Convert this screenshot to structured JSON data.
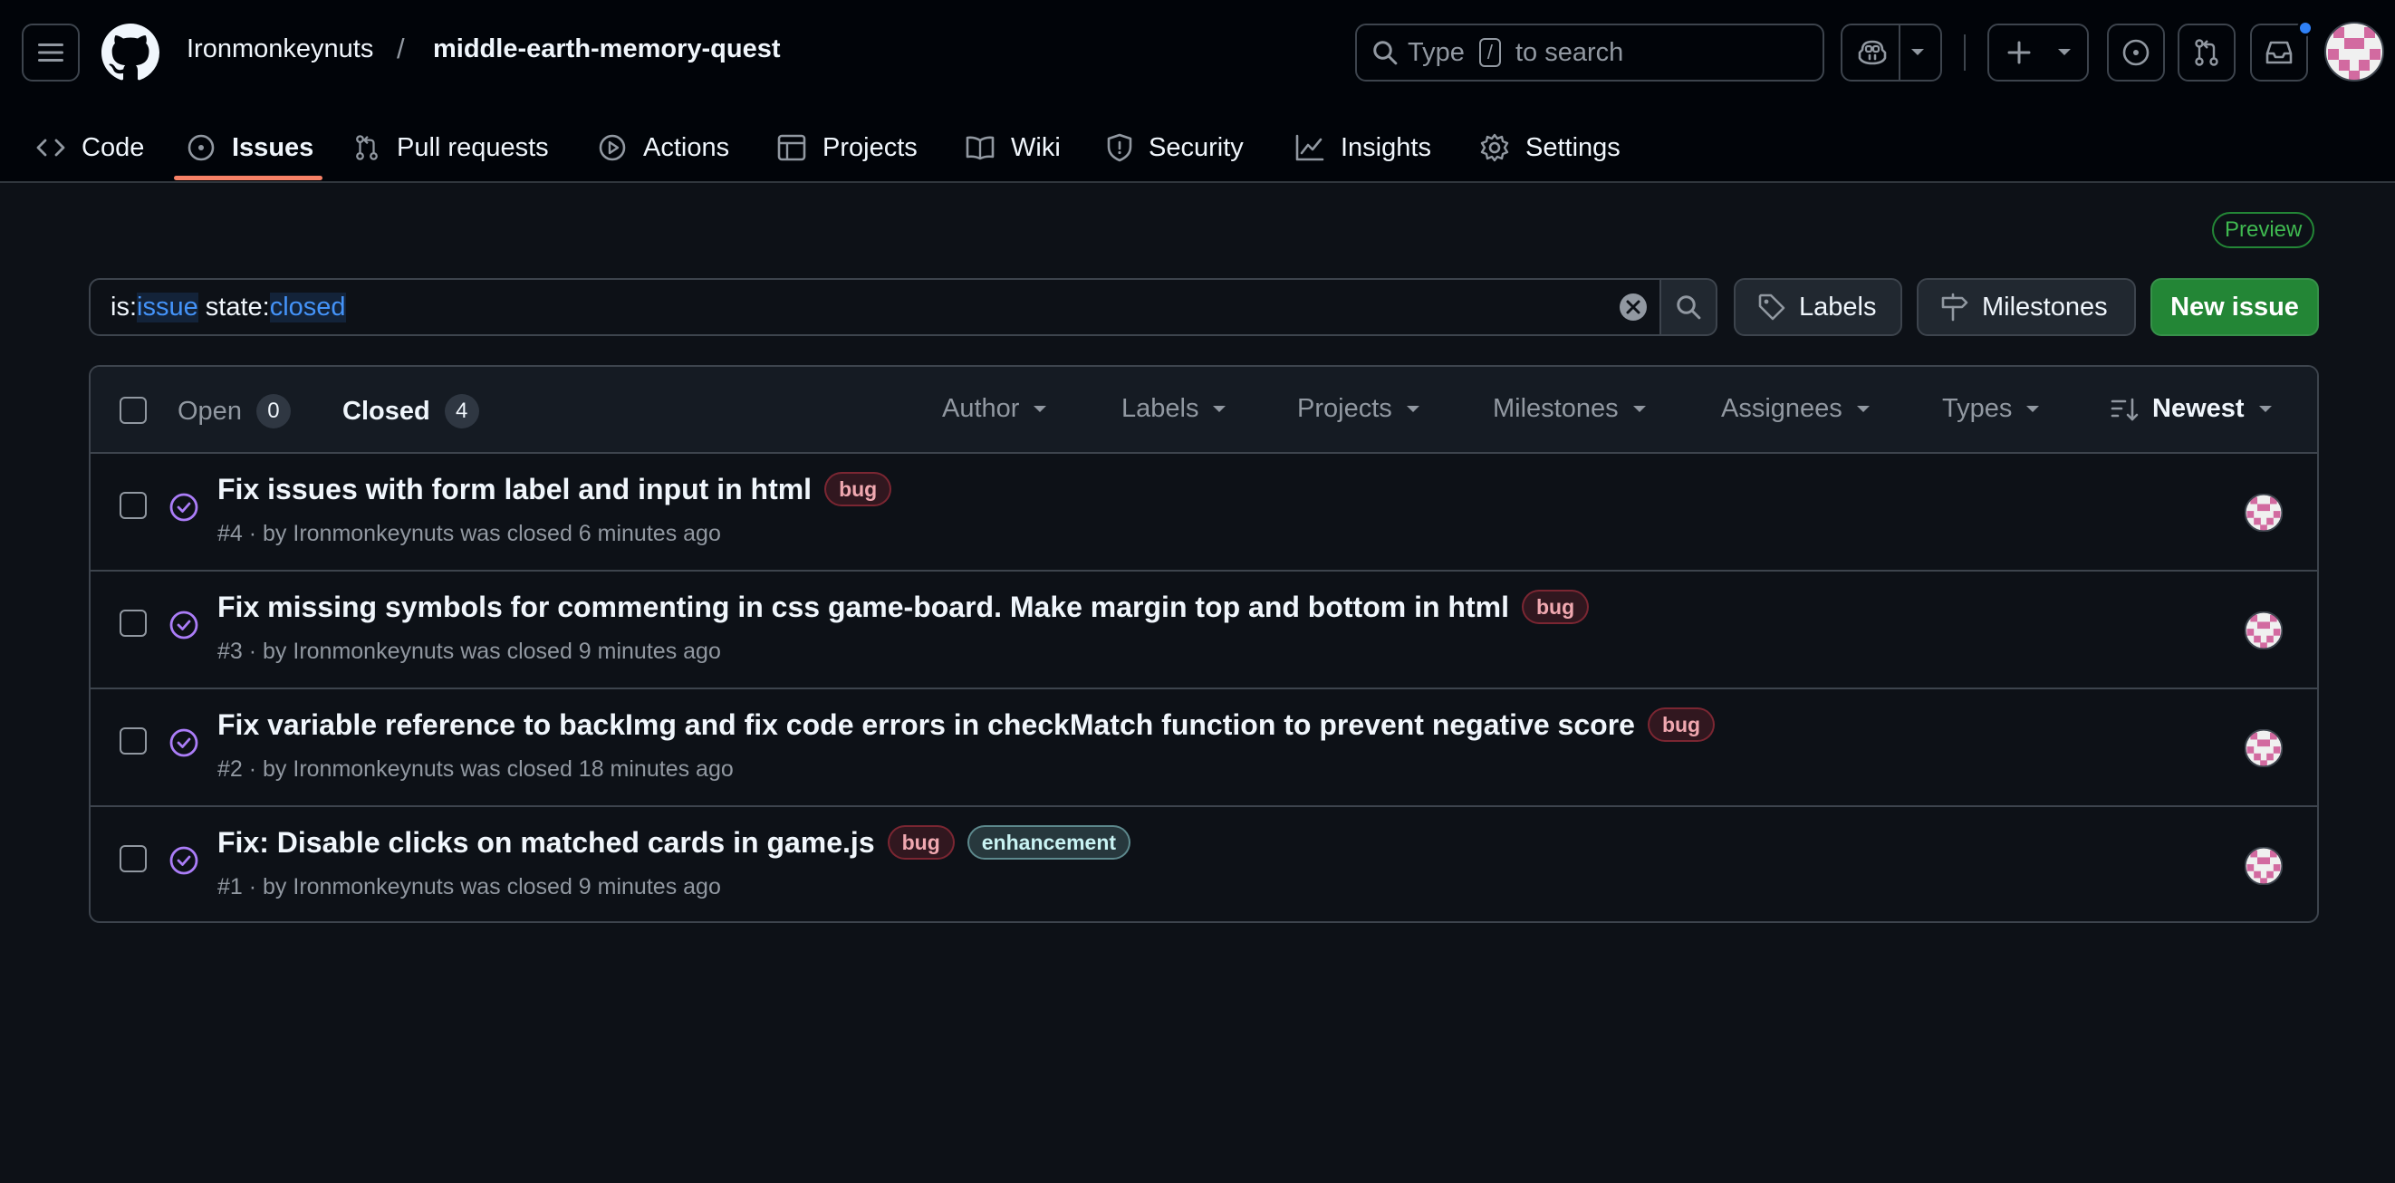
{
  "header": {
    "owner": "Ironmonkeynuts",
    "separator": "/",
    "repo": "middle-earth-memory-quest",
    "search_prefix": "Type",
    "search_key": "/",
    "search_suffix": "to search"
  },
  "tabs": [
    {
      "label": "Code",
      "icon": "code-icon"
    },
    {
      "label": "Issues",
      "icon": "issue-opened-icon",
      "active": true
    },
    {
      "label": "Pull requests",
      "icon": "git-pull-request-icon"
    },
    {
      "label": "Actions",
      "icon": "play-icon"
    },
    {
      "label": "Projects",
      "icon": "table-icon"
    },
    {
      "label": "Wiki",
      "icon": "book-icon"
    },
    {
      "label": "Security",
      "icon": "shield-icon"
    },
    {
      "label": "Insights",
      "icon": "graph-icon"
    },
    {
      "label": "Settings",
      "icon": "gear-icon"
    }
  ],
  "toolbar": {
    "preview_badge": "Preview",
    "query": [
      {
        "text": "is:",
        "kind": "key"
      },
      {
        "text": "issue",
        "kind": "value"
      },
      {
        "text": " state:",
        "kind": "key"
      },
      {
        "text": "closed",
        "kind": "value"
      }
    ],
    "labels_button": "Labels",
    "milestones_button": "Milestones",
    "new_issue_button": "New issue"
  },
  "list_header": {
    "open_label": "Open",
    "open_count": "0",
    "closed_label": "Closed",
    "closed_count": "4",
    "filters": [
      "Author",
      "Labels",
      "Projects",
      "Milestones",
      "Assignees",
      "Types"
    ],
    "sort_label": "Newest"
  },
  "issues": [
    {
      "title": "Fix issues with form label and input in html",
      "labels": [
        "bug"
      ],
      "meta": "#4 · by Ironmonkeynuts was closed 6 minutes ago"
    },
    {
      "title": "Fix missing symbols for commenting in css game-board. Make margin top and bottom in html",
      "labels": [
        "bug"
      ],
      "meta": "#3 · by Ironmonkeynuts was closed 9 minutes ago"
    },
    {
      "title": "Fix variable reference to backImg and fix code errors in checkMatch function to prevent negative score",
      "labels": [
        "bug"
      ],
      "meta": "#2 · by Ironmonkeynuts was closed 18 minutes ago"
    },
    {
      "title": "Fix: Disable clicks on matched cards in game.js",
      "labels": [
        "bug",
        "enhancement"
      ],
      "meta": "#1 · by Ironmonkeynuts was closed 9 minutes ago"
    }
  ],
  "colors": {
    "background": "#0d1117",
    "header_bg": "#010409",
    "accent_underline": "#f78166",
    "closed_icon": "#ab7df8",
    "primary_button": "#238636",
    "query_value": "#4493f8",
    "notification_dot": "#2f81f7"
  }
}
